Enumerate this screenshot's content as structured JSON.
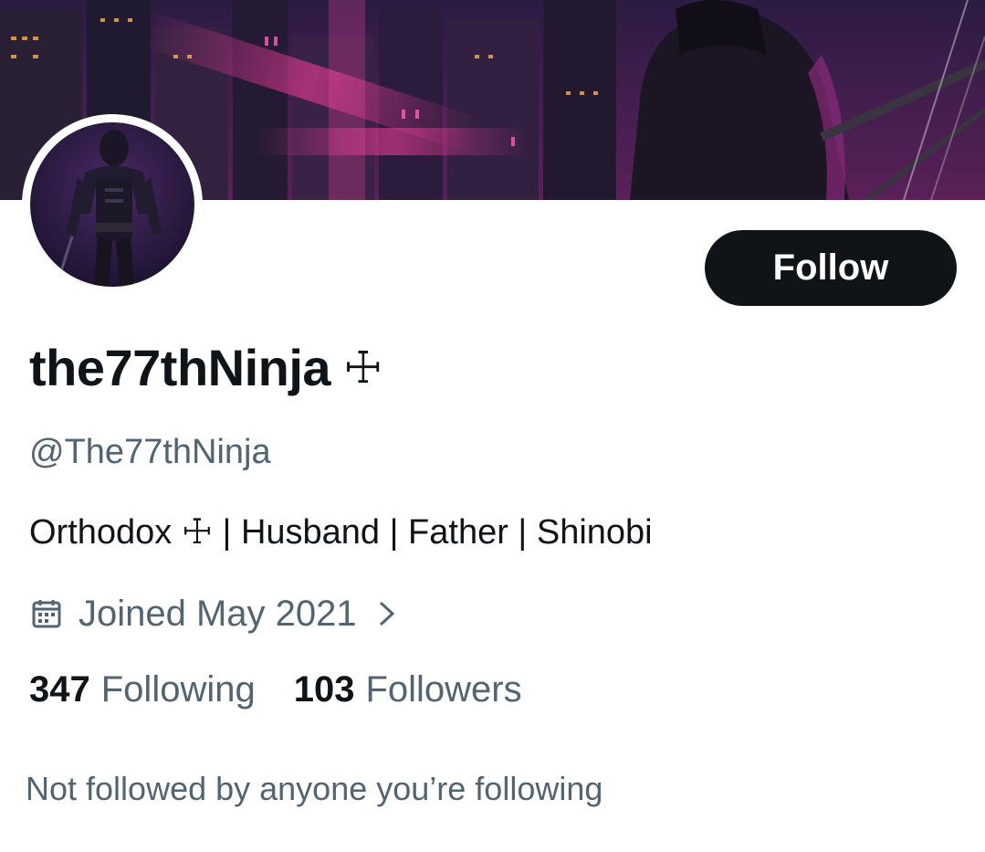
{
  "profile": {
    "display_name": "the77thNinja",
    "name_badge": "☩",
    "handle": "@The77thNinja",
    "bio_parts": {
      "first": "Orthodox ",
      "cross": "☩",
      "rest": " | Husband | Father | Shinobi"
    },
    "joined": "Joined May 2021",
    "following_count": "347",
    "following_label": "Following",
    "followers_count": "103",
    "followers_label": "Followers",
    "mutuals_note": "Not followed by anyone you’re following"
  },
  "actions": {
    "follow_label": "Follow"
  },
  "icons": {
    "joined_icon": "calendar-icon",
    "joined_chevron": "chevron-right-icon"
  },
  "colors": {
    "text_primary": "#0f1419",
    "text_secondary": "#536471",
    "button_bg": "#0f1419",
    "button_text": "#ffffff"
  }
}
